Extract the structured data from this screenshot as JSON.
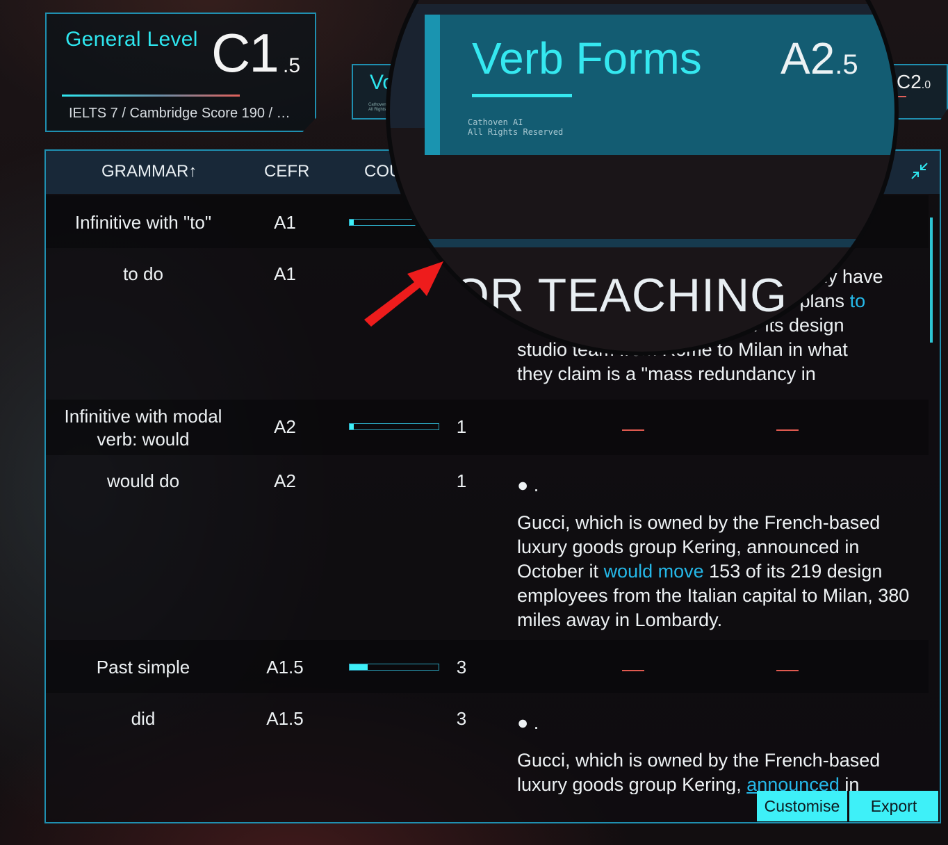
{
  "general": {
    "title": "General Level",
    "level": "C1",
    "sub": ".5",
    "scores": "IELTS 7 / Cambridge Score 190 / …"
  },
  "mini_left": {
    "title": "Vo",
    "copyright": "Cathoven AI\nAll Rights"
  },
  "mini_right": {
    "level": "C2",
    "sub": ".0"
  },
  "magnifier": {
    "title": "Verb Forms",
    "level": "A2",
    "sub": ".5",
    "copyright_line1": "Cathoven AI",
    "copyright_line2": "All Rights Reserved",
    "teaching": "OR TEACHING"
  },
  "table": {
    "headers": {
      "grammar": "GRAMMAR↑",
      "cefr": "CEFR",
      "count": "COU"
    },
    "rows": [
      {
        "grammar": "Infinitive with \"to\"",
        "cefr": "A1",
        "bar_fraction": 0.05
      },
      {
        "grammar": "to do",
        "cefr": "A1",
        "ex_a": "ally have",
        "ex_b": "r plans",
        "ex_b_hl": "to",
        "ex_c": "r its design",
        "ex_d": "studio team from Rome to Milan in what",
        "ex_e": "they claim is a \"mass redundancy in"
      },
      {
        "grammar": "Infinitive with modal verb: would",
        "cefr": "A2",
        "bar_fraction": 0.05,
        "count": "1"
      },
      {
        "grammar": "would do",
        "cefr": "A2",
        "count": "1",
        "bullet": "● .",
        "ex_pre": "Gucci, which is owned by the French-based luxury goods group Kering, announced in October it",
        "ex_hl": "would move",
        "ex_post": "153 of its 219 design employees from the Italian capital to Milan, 380 miles away in Lombardy."
      },
      {
        "grammar": "Past simple",
        "cefr": "A1.5",
        "bar_fraction": 0.2,
        "count": "3"
      },
      {
        "grammar": "did",
        "cefr": "A1.5",
        "count": "3",
        "bullet": "● .",
        "ex_pre": "Gucci, which is owned by the French-based luxury goods group Kering,",
        "ex_hl": "announced",
        "ex_post": "in"
      }
    ]
  },
  "buttons": {
    "customise": "Customise",
    "export": "Export"
  },
  "colors": {
    "accent": "#3ef0f8",
    "border": "#1f8fb0",
    "highlight": "#25b8e8",
    "dash": "#e05a50"
  }
}
